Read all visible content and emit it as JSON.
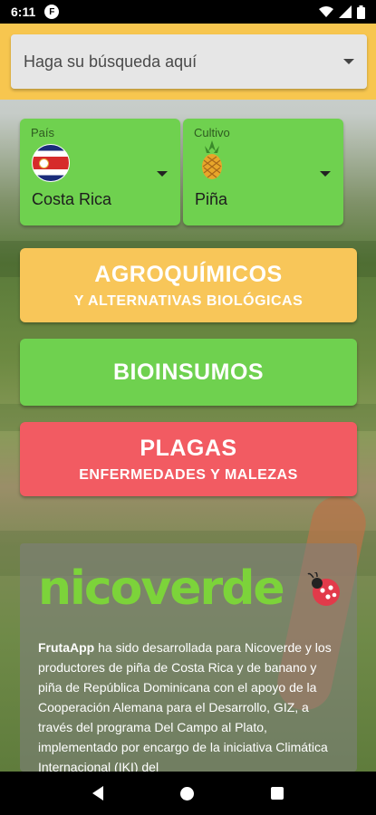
{
  "status": {
    "time": "6:11",
    "app_badge": "F"
  },
  "search": {
    "placeholder": "Haga su búsqueda aquí"
  },
  "country": {
    "label": "País",
    "value": "Costa Rica",
    "flag": "costa-rica-flag"
  },
  "crop": {
    "label": "Cultivo",
    "value": "Piña",
    "icon": "pineapple-icon"
  },
  "buttons": {
    "agro_main": "AGROQUÍMICOS",
    "agro_sub": "Y ALTERNATIVAS BIOLÓGICAS",
    "bio_main": "BIOINSUMOS",
    "plagas_main": "PLAGAS",
    "plagas_sub": "ENFERMEDADES Y MALEZAS"
  },
  "info": {
    "logo": "nicoverde",
    "brand": "FrutaApp",
    "text": " ha sido desarrollada para Nicoverde y los productores de piña de Costa Rica y de banano y piña de República Dominicana con el apoyo de la Cooperación Alemana para el Desarrollo, GIZ, a través del programa Del Campo al Plato, implementado por encargo de la iniciativa Climática Internacional (IKI) del"
  },
  "colors": {
    "header": "#f7c64f",
    "green": "#6fd14f",
    "yellow": "#f8c659",
    "red": "#f25b62"
  }
}
